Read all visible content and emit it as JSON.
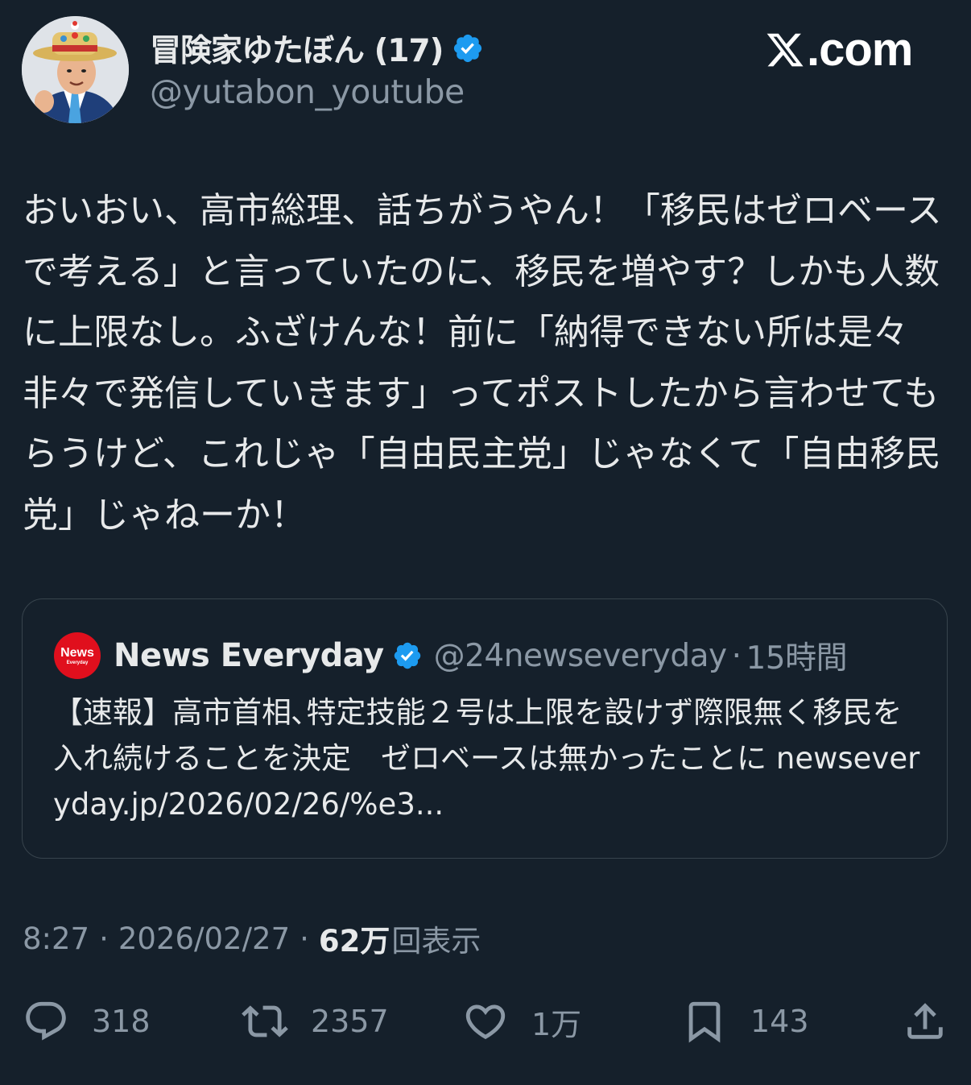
{
  "author": {
    "display_name": "冒険家ゆたぼん (17)",
    "handle": "@yutabon_youtube",
    "verified": true,
    "avatar_icon": "profile-photo"
  },
  "brand": {
    "logo_icon": "x-logo",
    "suffix": ".com"
  },
  "tweet": {
    "text": "おいおい、高市総理、話ちがうやん！「移民はゼロベースで考える」と言っていたのに、移民を増やす？しかも人数に上限なし。ふざけんな！前に「納得できない所は是々非々で発信していきます」ってポストしたから言わせてもらうけど、これじゃ「自由民主党」じゃなくて「自由移民党」じゃねーか！"
  },
  "quote": {
    "avatar_logo_text": "News",
    "avatar_logo_subtext": "Everyday",
    "display_name": "News Everyday",
    "verified": true,
    "handle": "@24newseveryday",
    "separator": "·",
    "time": "15時間",
    "text": "【速報】高市首相､特定技能２号は上限を設けず際限無く移民を入れ続けることを決定　ゼロベースは無かったことに newseveryday.jp/2026/02/26/%e3..."
  },
  "meta": {
    "time": "8:27",
    "separator": "·",
    "date": "2026/02/27",
    "views_count": "62万",
    "views_label": "回表示"
  },
  "actions": {
    "reply_count": "318",
    "retweet_count": "2357",
    "like_count": "1万",
    "bookmark_count": "143"
  },
  "colors": {
    "background": "#15202b",
    "text_primary": "#e7e9ea",
    "text_secondary": "#8b98a5",
    "verified_badge": "#1d9bf0",
    "border": "#38444d",
    "quote_avatar_bg": "#e00f1d"
  }
}
